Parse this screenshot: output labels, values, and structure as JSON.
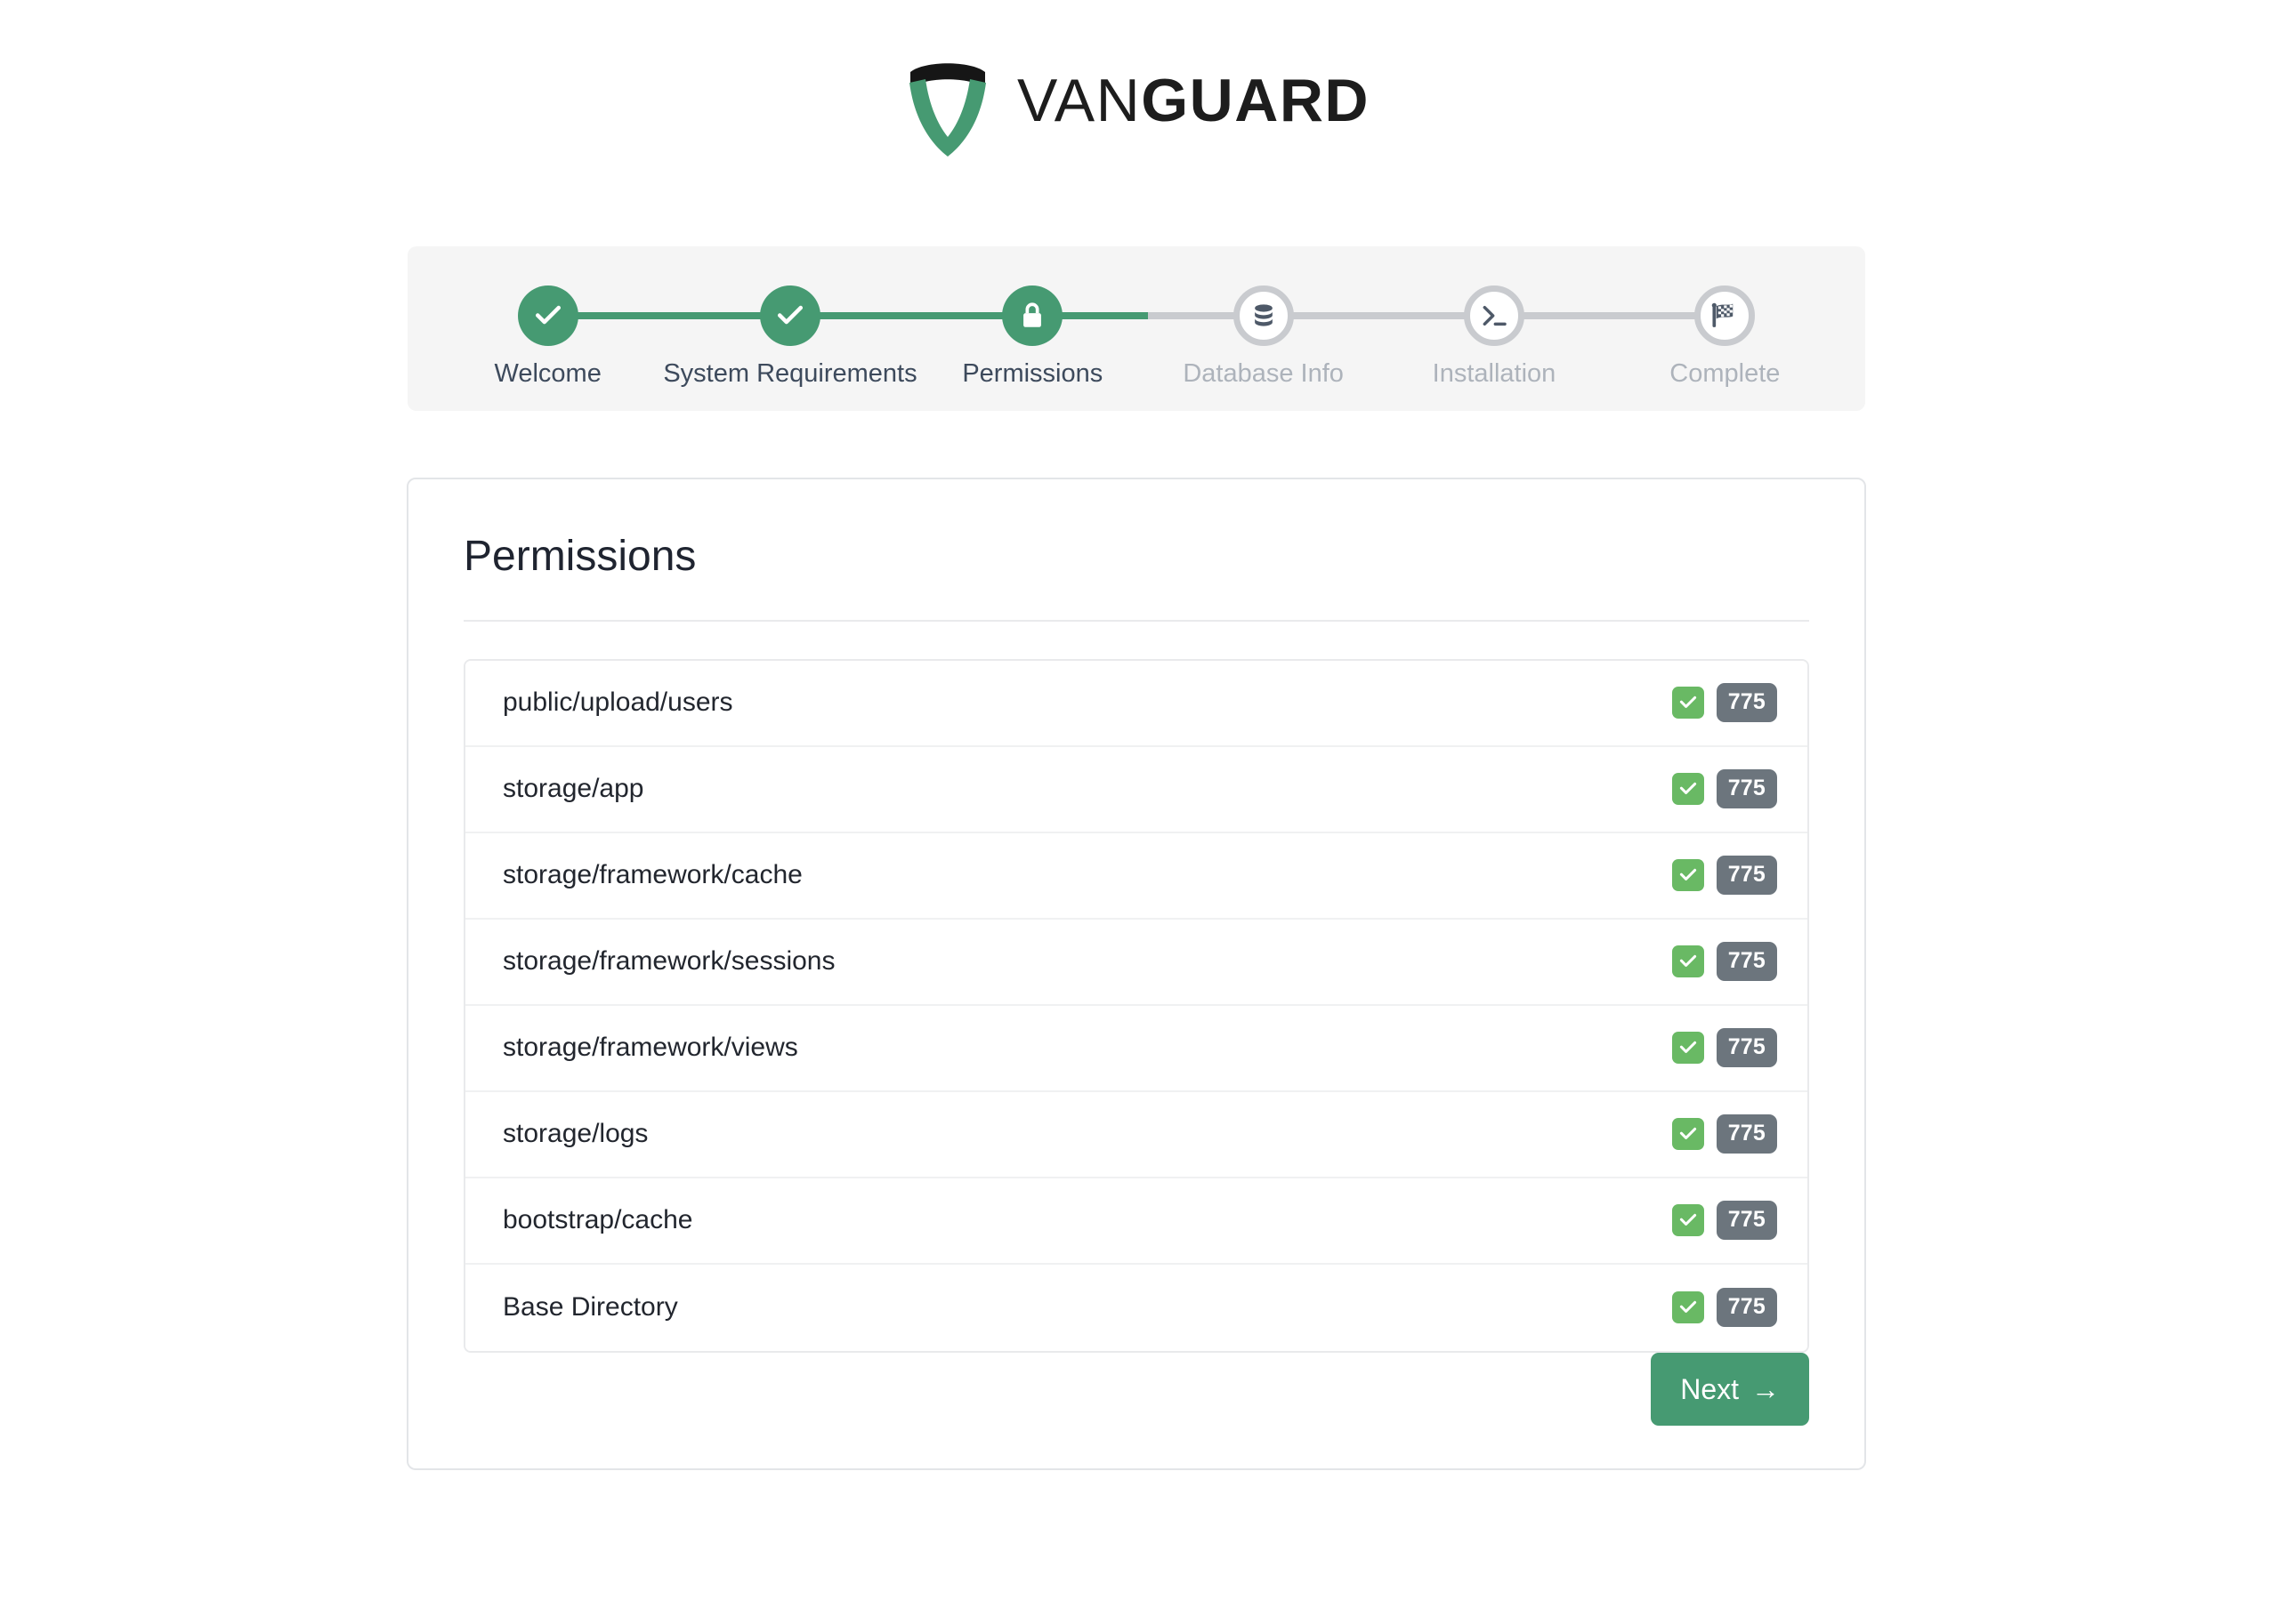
{
  "brand": {
    "name_light": "VAN",
    "name_bold": "GUARD",
    "logo_icon": "shield-logo-icon",
    "green": "#469a72",
    "dark": "#1d1d1d"
  },
  "stepper": {
    "background": "#f5f5f5",
    "active_color": "#469a72",
    "inactive_color": "#c9cbcf",
    "steps": [
      {
        "label": "Welcome",
        "state": "done",
        "icon": "check-icon"
      },
      {
        "label": "System Requirements",
        "state": "done",
        "icon": "check-icon"
      },
      {
        "label": "Permissions",
        "state": "active",
        "icon": "lock-icon"
      },
      {
        "label": "Database Info",
        "state": "todo",
        "icon": "database-icon"
      },
      {
        "label": "Installation",
        "state": "todo",
        "icon": "terminal-icon"
      },
      {
        "label": "Complete",
        "state": "todo",
        "icon": "checkered-flag-icon"
      }
    ]
  },
  "card": {
    "title": "Permissions",
    "permissions": [
      {
        "path": "public/upload/users",
        "mode": "775",
        "ok": true
      },
      {
        "path": "storage/app",
        "mode": "775",
        "ok": true
      },
      {
        "path": "storage/framework/cache",
        "mode": "775",
        "ok": true
      },
      {
        "path": "storage/framework/sessions",
        "mode": "775",
        "ok": true
      },
      {
        "path": "storage/framework/views",
        "mode": "775",
        "ok": true
      },
      {
        "path": "storage/logs",
        "mode": "775",
        "ok": true
      },
      {
        "path": "bootstrap/cache",
        "mode": "775",
        "ok": true
      },
      {
        "path": "Base Directory",
        "mode": "775",
        "ok": true
      }
    ],
    "next_label": "Next",
    "next_arrow": "→",
    "badge_color": "#6c757d",
    "check_color": "#69b964"
  }
}
